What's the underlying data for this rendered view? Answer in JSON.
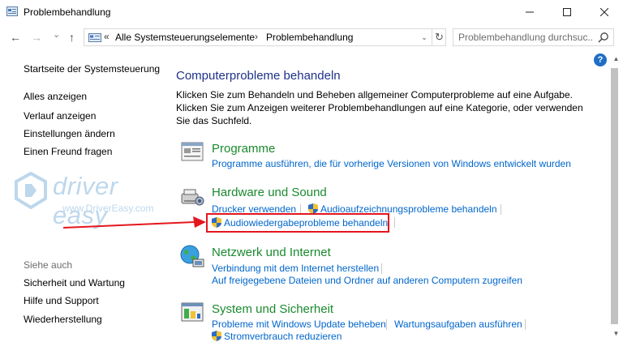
{
  "window": {
    "title": "Problembehandlung",
    "minimize": "—",
    "maximize": "☐",
    "close": "✕"
  },
  "nav": {
    "back": "←",
    "forward": "→",
    "history": "⌄",
    "up": "↑",
    "breadcrumb": {
      "overflow": "«",
      "root": "Alle Systemsteuerungselemente",
      "sep": "›",
      "current": "Problembehandlung"
    },
    "dropdown": "⌄",
    "refresh": "↻"
  },
  "search": {
    "placeholder": "Problembehandlung durchsuc..."
  },
  "sidebar": {
    "home": "Startseite der Systemsteuerung",
    "items": [
      "Alles anzeigen",
      "Verlauf anzeigen",
      "Einstellungen ändern",
      "Einen Freund fragen"
    ],
    "see_also": "Siehe auch",
    "see_also_items": [
      "Sicherheit und Wartung",
      "Hilfe und Support",
      "Wiederherstellung"
    ]
  },
  "watermark": {
    "logo_text": "driver easy",
    "url": "www.DriverEasy.com"
  },
  "main": {
    "title": "Computerprobleme behandeln",
    "intro": "Klicken Sie zum Behandeln und Beheben allgemeiner Computerprobleme auf eine Aufgabe. Klicken Sie zum Anzeigen weiterer Problembehandlungen auf eine Kategorie, oder verwenden Sie das Suchfeld.",
    "categories": [
      {
        "title": "Programme",
        "icon": "programs-icon",
        "links": [
          "Programme ausführen, die für vorherige Versionen von Windows entwickelt wurden"
        ]
      },
      {
        "title": "Hardware und Sound",
        "icon": "hardware-sound-icon",
        "links": [
          "Drucker verwenden",
          "Audioaufzeichnungsprobleme behandeln",
          "Audiowiedergabeprobleme behandeln"
        ]
      },
      {
        "title": "Netzwerk und Internet",
        "icon": "network-globe-icon",
        "links": [
          "Verbindung mit dem Internet herstellen",
          "Auf freigegebene Dateien und Ordner auf anderen Computern zugreifen"
        ]
      },
      {
        "title": "System und Sicherheit",
        "icon": "system-security-icon",
        "links": [
          "Probleme mit Windows Update beheben",
          "Wartungsaufgaben ausführen",
          "Stromverbrauch reduzieren"
        ]
      }
    ]
  },
  "help": {
    "label": "?"
  },
  "scrollbar": {
    "up": "▲",
    "down": "▼"
  },
  "colors": {
    "category_title": "#1a8a2e",
    "page_title": "#1e3287",
    "link": "#0066cc",
    "highlight": "#e4161e"
  }
}
